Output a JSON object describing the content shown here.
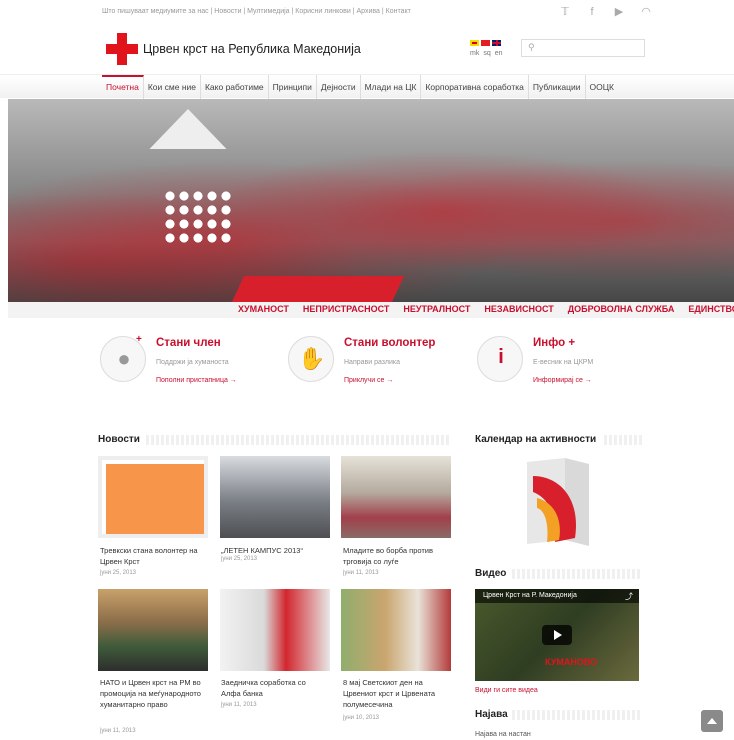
{
  "top_links": "Што пишуваат медиумите за нас | Новости | Мултимедија | Корисни линкови | Архива | Контакт",
  "social": [
    {
      "icon": "twitter-icon",
      "glyph": "𝕋"
    },
    {
      "icon": "facebook-icon",
      "glyph": "f"
    },
    {
      "icon": "youtube-icon",
      "glyph": "▶"
    },
    {
      "icon": "rss-icon",
      "glyph": "◠"
    }
  ],
  "header": {
    "title": "Црвен крст на Република Македонија",
    "languages": [
      "mk",
      "sq",
      "en"
    ],
    "search_placeholder": ""
  },
  "nav": [
    {
      "label": "Почетна",
      "active": true
    },
    {
      "label": "Кои сме ние"
    },
    {
      "label": "Како работиме"
    },
    {
      "label": "Принципи"
    },
    {
      "label": "Дејности"
    },
    {
      "label": "Млади на ЦК"
    },
    {
      "label": "Корпоративна соработка"
    },
    {
      "label": "Публикации"
    },
    {
      "label": "ООЦК"
    }
  ],
  "values": [
    "ХУМАНОСТ",
    "НЕПРИСТРАСНОСТ",
    "НЕУТРАЛНОСТ",
    "НЕЗАВИСНОСТ",
    "ДОБРОВОЛНА СЛУЖБА",
    "ЕДИНСТВО"
  ],
  "cta": [
    {
      "title": "Стани член",
      "subtitle": "Поддржи ја хуманоста",
      "link": "Пополни пристапница →",
      "icon": "member-icon"
    },
    {
      "title": "Стани волонтер",
      "subtitle": "Направи разлика",
      "link": "Приклучи се →",
      "icon": "volunteer-hand-icon"
    },
    {
      "title": "Инфо +",
      "subtitle": "Е-весник на ЦКРМ",
      "link": "Информирај се →",
      "icon": "info-people-icon"
    }
  ],
  "news": {
    "title": "Новости",
    "items": [
      {
        "caption": "Тревкски стана волонтер на Црвен Крст",
        "date": "јуни 25, 2013"
      },
      {
        "caption": "„ЛЕТЕН КАМПУС 2013“",
        "date": "јуни 25, 2013"
      },
      {
        "caption": "Младите во борба против трговија со луѓе",
        "date": "јуни 11, 2013"
      },
      {
        "caption": "НАТО и Црвен крст на РМ во промоција на меѓународното хуманитарно право",
        "date": "јуни 11, 2013"
      },
      {
        "caption": "Заедничка соработка со Алфа банка",
        "date": "јуни 11, 2013"
      },
      {
        "caption": "8 мај Светскиот ден на Црвениот крст и Црвената полумесечина",
        "date": "јуни 10, 2013"
      }
    ]
  },
  "calendar": {
    "title": "Календар на активности"
  },
  "video": {
    "title": "Видео",
    "video_title": "Црвен Крст на Р. Македонија",
    "overlay": "КУМАНОВО",
    "link": "Види ги сите видеа"
  },
  "latest": {
    "title": "Најава",
    "item": "Најава на настан"
  },
  "colors": {
    "brand_red": "#c8102e",
    "placeholder_orange": "#f7964a"
  }
}
